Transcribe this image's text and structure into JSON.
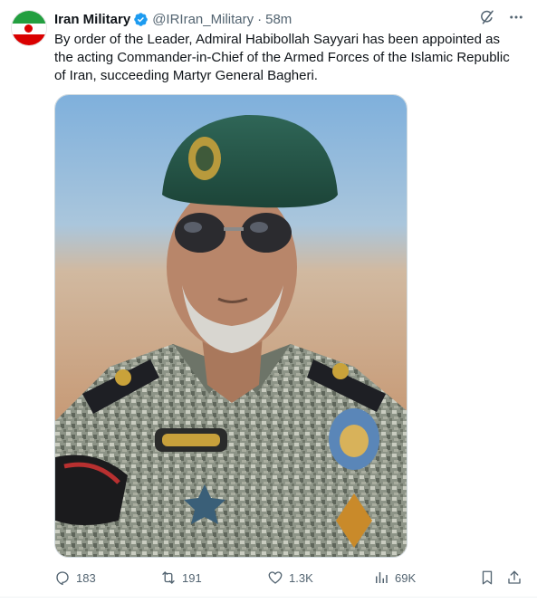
{
  "post": {
    "author_name": "Iran Military",
    "handle": "@IRIran_Military",
    "separator": "·",
    "time": "58m",
    "text": "By order of the Leader, Admiral Habibollah Sayyari has been appointed as the acting Commander-in-Chief of the Armed Forces of the Islamic Republic of Iran, succeeding Martyr General Bagheri."
  },
  "actions": {
    "replies": "183",
    "reposts": "191",
    "likes": "1.3K",
    "views": "69K"
  },
  "colors": {
    "accent": "#1d9bf0",
    "text_secondary": "#536471",
    "flag_green": "#239f40",
    "flag_red": "#da0000"
  },
  "icons": {
    "verified": "verified-badge-icon",
    "grok": "grok-icon",
    "more": "more-icon",
    "reply": "reply-icon",
    "repost": "repost-icon",
    "like": "heart-icon",
    "views": "views-icon",
    "bookmark": "bookmark-icon",
    "share": "share-icon"
  }
}
